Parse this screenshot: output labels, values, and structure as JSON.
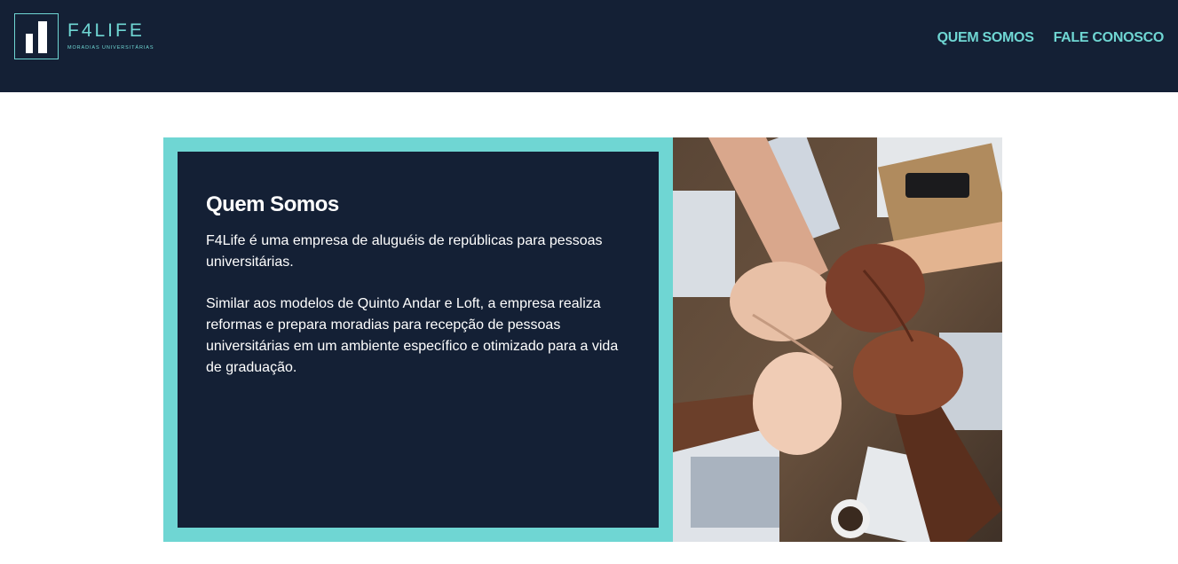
{
  "brand": {
    "name": "F4LIFE",
    "tagline": "MORADIAS UNIVERSITÁRIAS"
  },
  "nav": {
    "items": [
      {
        "label": "QUEM SOMOS"
      },
      {
        "label": "FALE CONOSCO"
      }
    ]
  },
  "about": {
    "title": "Quem Somos",
    "paragraphs": [
      "F4Life é uma empresa de aluguéis de repúblicas para pessoas universitárias.",
      "Similar aos modelos de Quinto Andar e Loft, a empresa realiza reformas e prepara moradias para recepção de pessoas universitárias em um ambiente específico e otimizado para a vida de graduação."
    ]
  },
  "colors": {
    "navy": "#142035",
    "accent": "#6fd6d3",
    "text": "#ffffff"
  },
  "icons": [
    "logo-bars-icon"
  ]
}
